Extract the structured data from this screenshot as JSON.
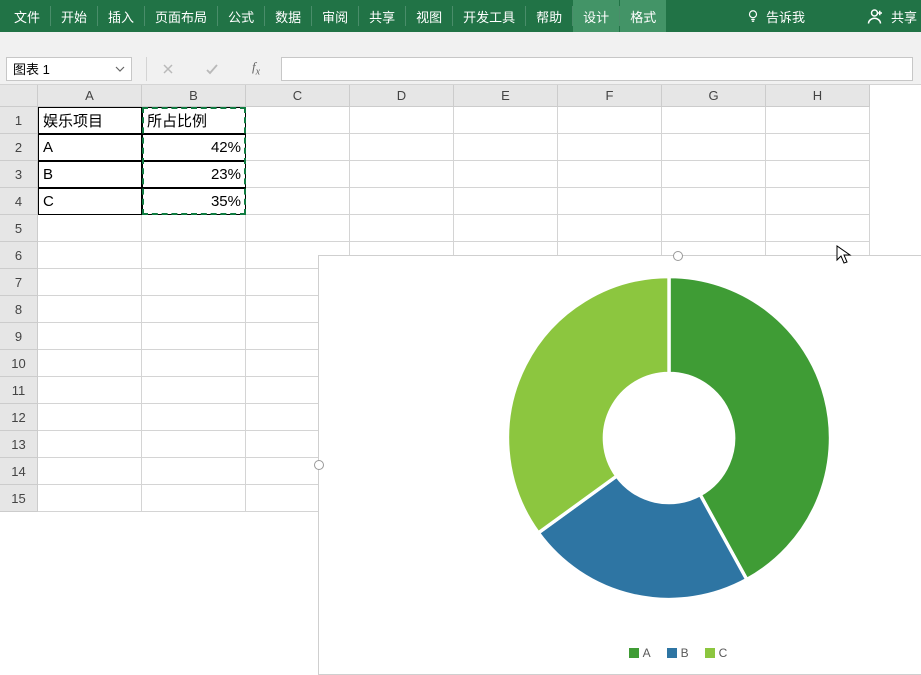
{
  "ribbon": {
    "tabs": [
      "文件",
      "开始",
      "插入",
      "页面布局",
      "公式",
      "数据",
      "审阅",
      "共享",
      "视图",
      "开发工具",
      "帮助",
      "设计",
      "格式"
    ],
    "active_tabs": [
      "设计",
      "格式"
    ],
    "tell_me": "告诉我",
    "share": "共享"
  },
  "formula_bar": {
    "name_box": "图表 1",
    "formula": ""
  },
  "columns": [
    "A",
    "B",
    "C",
    "D",
    "E",
    "F",
    "G",
    "H"
  ],
  "rows": [
    "1",
    "2",
    "3",
    "4",
    "5",
    "6",
    "7",
    "8",
    "9",
    "10",
    "11",
    "12",
    "13",
    "14",
    "15"
  ],
  "column_widths": {
    "A": 104,
    "B": 104,
    "C": 104,
    "D": 104,
    "E": 104,
    "F": 104,
    "G": 104,
    "H": 104
  },
  "table": {
    "headers": [
      "娱乐项目",
      "所占比例"
    ],
    "rows": [
      {
        "label": "A",
        "value": "42%"
      },
      {
        "label": "B",
        "value": "23%"
      },
      {
        "label": "C",
        "value": "35%"
      }
    ]
  },
  "chart_data": {
    "type": "pie",
    "subtype": "doughnut",
    "categories": [
      "A",
      "B",
      "C"
    ],
    "values": [
      42,
      23,
      35
    ],
    "colors": {
      "A": "#3f9c35",
      "B": "#2e75a3",
      "C": "#8cc63f"
    },
    "legend_position": "bottom",
    "hole_ratio": 0.4
  }
}
